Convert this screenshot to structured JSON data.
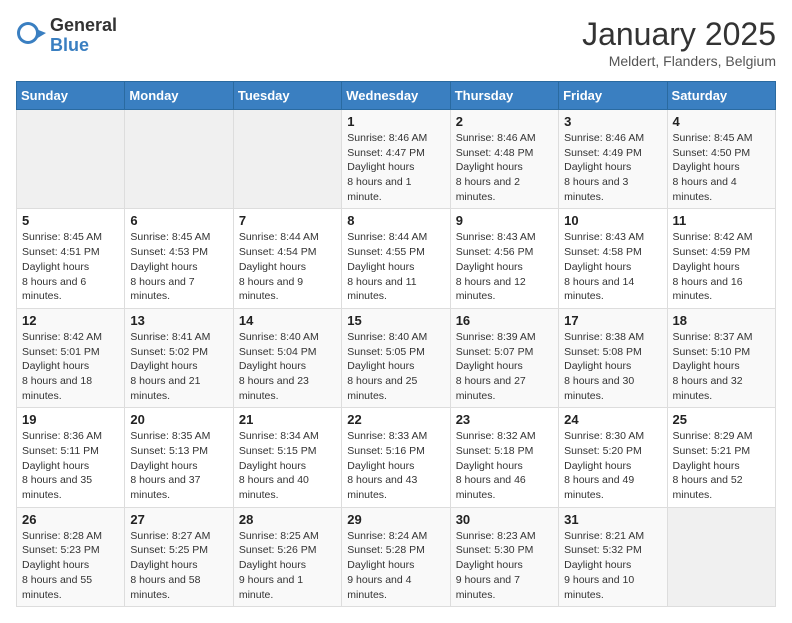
{
  "header": {
    "logo_general": "General",
    "logo_blue": "Blue",
    "month_title": "January 2025",
    "location": "Meldert, Flanders, Belgium"
  },
  "weekdays": [
    "Sunday",
    "Monday",
    "Tuesday",
    "Wednesday",
    "Thursday",
    "Friday",
    "Saturday"
  ],
  "weeks": [
    [
      {
        "day": "",
        "sunrise": "",
        "sunset": "",
        "daylight": ""
      },
      {
        "day": "",
        "sunrise": "",
        "sunset": "",
        "daylight": ""
      },
      {
        "day": "",
        "sunrise": "",
        "sunset": "",
        "daylight": ""
      },
      {
        "day": "1",
        "sunrise": "8:46 AM",
        "sunset": "4:47 PM",
        "daylight": "8 hours and 1 minute."
      },
      {
        "day": "2",
        "sunrise": "8:46 AM",
        "sunset": "4:48 PM",
        "daylight": "8 hours and 2 minutes."
      },
      {
        "day": "3",
        "sunrise": "8:46 AM",
        "sunset": "4:49 PM",
        "daylight": "8 hours and 3 minutes."
      },
      {
        "day": "4",
        "sunrise": "8:45 AM",
        "sunset": "4:50 PM",
        "daylight": "8 hours and 4 minutes."
      }
    ],
    [
      {
        "day": "5",
        "sunrise": "8:45 AM",
        "sunset": "4:51 PM",
        "daylight": "8 hours and 6 minutes."
      },
      {
        "day": "6",
        "sunrise": "8:45 AM",
        "sunset": "4:53 PM",
        "daylight": "8 hours and 7 minutes."
      },
      {
        "day": "7",
        "sunrise": "8:44 AM",
        "sunset": "4:54 PM",
        "daylight": "8 hours and 9 minutes."
      },
      {
        "day": "8",
        "sunrise": "8:44 AM",
        "sunset": "4:55 PM",
        "daylight": "8 hours and 11 minutes."
      },
      {
        "day": "9",
        "sunrise": "8:43 AM",
        "sunset": "4:56 PM",
        "daylight": "8 hours and 12 minutes."
      },
      {
        "day": "10",
        "sunrise": "8:43 AM",
        "sunset": "4:58 PM",
        "daylight": "8 hours and 14 minutes."
      },
      {
        "day": "11",
        "sunrise": "8:42 AM",
        "sunset": "4:59 PM",
        "daylight": "8 hours and 16 minutes."
      }
    ],
    [
      {
        "day": "12",
        "sunrise": "8:42 AM",
        "sunset": "5:01 PM",
        "daylight": "8 hours and 18 minutes."
      },
      {
        "day": "13",
        "sunrise": "8:41 AM",
        "sunset": "5:02 PM",
        "daylight": "8 hours and 21 minutes."
      },
      {
        "day": "14",
        "sunrise": "8:40 AM",
        "sunset": "5:04 PM",
        "daylight": "8 hours and 23 minutes."
      },
      {
        "day": "15",
        "sunrise": "8:40 AM",
        "sunset": "5:05 PM",
        "daylight": "8 hours and 25 minutes."
      },
      {
        "day": "16",
        "sunrise": "8:39 AM",
        "sunset": "5:07 PM",
        "daylight": "8 hours and 27 minutes."
      },
      {
        "day": "17",
        "sunrise": "8:38 AM",
        "sunset": "5:08 PM",
        "daylight": "8 hours and 30 minutes."
      },
      {
        "day": "18",
        "sunrise": "8:37 AM",
        "sunset": "5:10 PM",
        "daylight": "8 hours and 32 minutes."
      }
    ],
    [
      {
        "day": "19",
        "sunrise": "8:36 AM",
        "sunset": "5:11 PM",
        "daylight": "8 hours and 35 minutes."
      },
      {
        "day": "20",
        "sunrise": "8:35 AM",
        "sunset": "5:13 PM",
        "daylight": "8 hours and 37 minutes."
      },
      {
        "day": "21",
        "sunrise": "8:34 AM",
        "sunset": "5:15 PM",
        "daylight": "8 hours and 40 minutes."
      },
      {
        "day": "22",
        "sunrise": "8:33 AM",
        "sunset": "5:16 PM",
        "daylight": "8 hours and 43 minutes."
      },
      {
        "day": "23",
        "sunrise": "8:32 AM",
        "sunset": "5:18 PM",
        "daylight": "8 hours and 46 minutes."
      },
      {
        "day": "24",
        "sunrise": "8:30 AM",
        "sunset": "5:20 PM",
        "daylight": "8 hours and 49 minutes."
      },
      {
        "day": "25",
        "sunrise": "8:29 AM",
        "sunset": "5:21 PM",
        "daylight": "8 hours and 52 minutes."
      }
    ],
    [
      {
        "day": "26",
        "sunrise": "8:28 AM",
        "sunset": "5:23 PM",
        "daylight": "8 hours and 55 minutes."
      },
      {
        "day": "27",
        "sunrise": "8:27 AM",
        "sunset": "5:25 PM",
        "daylight": "8 hours and 58 minutes."
      },
      {
        "day": "28",
        "sunrise": "8:25 AM",
        "sunset": "5:26 PM",
        "daylight": "9 hours and 1 minute."
      },
      {
        "day": "29",
        "sunrise": "8:24 AM",
        "sunset": "5:28 PM",
        "daylight": "9 hours and 4 minutes."
      },
      {
        "day": "30",
        "sunrise": "8:23 AM",
        "sunset": "5:30 PM",
        "daylight": "9 hours and 7 minutes."
      },
      {
        "day": "31",
        "sunrise": "8:21 AM",
        "sunset": "5:32 PM",
        "daylight": "9 hours and 10 minutes."
      },
      {
        "day": "",
        "sunrise": "",
        "sunset": "",
        "daylight": ""
      }
    ]
  ]
}
